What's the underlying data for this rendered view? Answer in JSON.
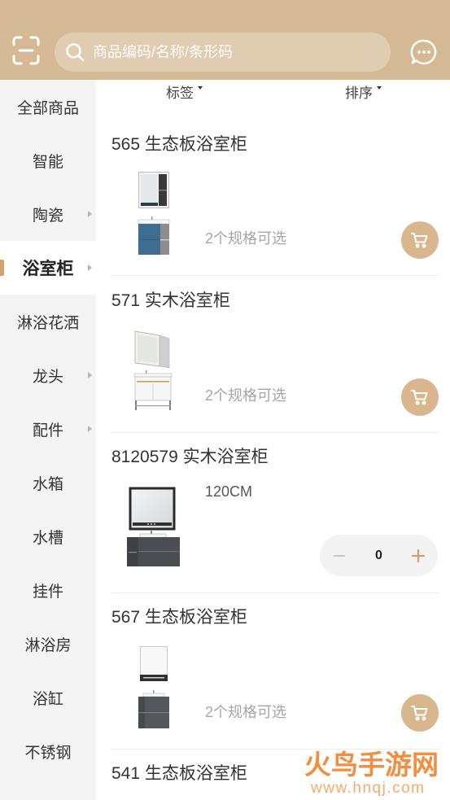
{
  "header": {
    "scan_icon": "scan-icon",
    "search": {
      "icon": "search-icon",
      "placeholder": "商品编码/名称/条形码"
    },
    "message_icon": "chat-bubble-icon"
  },
  "theme": {
    "header_bg": "#d5b994",
    "accent": "#d8b78e",
    "accent_dark": "#c9a174",
    "sidebar_bg": "#f4f4f4",
    "selected_marker": "#d4a36a",
    "muted_text": "#a6a6a6"
  },
  "sidebar": {
    "items": [
      {
        "label": "全部商品"
      },
      {
        "label": "智能"
      },
      {
        "label": "陶瓷",
        "icon": "caret-right-icon"
      },
      {
        "label": "浴室柜",
        "icon": "caret-right-icon",
        "selected": true
      },
      {
        "label": "淋浴花洒"
      },
      {
        "label": "龙头",
        "icon": "caret-right-icon"
      },
      {
        "label": "配件",
        "icon": "caret-right-icon"
      },
      {
        "label": "水箱"
      },
      {
        "label": "水槽"
      },
      {
        "label": "挂件"
      },
      {
        "label": "淋浴房"
      },
      {
        "label": "浴缸"
      },
      {
        "label": "不锈钢"
      }
    ]
  },
  "filters": {
    "tag": {
      "label": "标签",
      "icon": "caret-down-icon"
    },
    "sort": {
      "label": "排序",
      "icon": "caret-down-icon"
    }
  },
  "products": [
    {
      "title": "565 生态板浴室柜",
      "spec": "2个规格可选",
      "action_icon": "cart-icon"
    },
    {
      "title": "571 实木浴室柜",
      "spec": "2个规格可选",
      "action_icon": "cart-icon"
    },
    {
      "title": "8120579 实木浴室柜",
      "spec": "120CM",
      "quantity": 0,
      "decrement_icon": "minus-icon",
      "increment_icon": "plus-icon"
    },
    {
      "title": "567 生态板浴室柜",
      "spec": "2个规格可选",
      "action_icon": "cart-icon"
    },
    {
      "title": "541 生态板浴室柜"
    }
  ],
  "watermark": {
    "brand": "火鸟手游网",
    "url": "www.hnqj.com"
  }
}
